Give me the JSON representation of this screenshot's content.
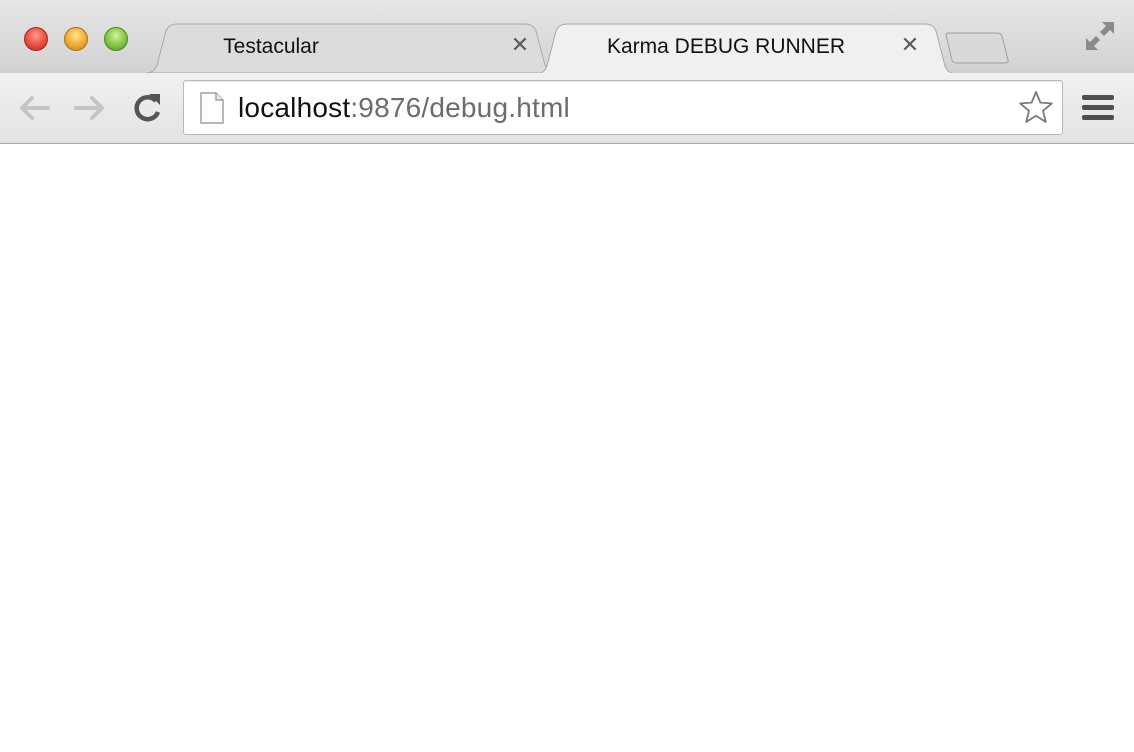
{
  "window": {
    "tabs": [
      {
        "title": "Testacular",
        "active": false
      },
      {
        "title": "Karma DEBUG RUNNER",
        "active": true
      }
    ]
  },
  "toolbar": {
    "url_host": "localhost",
    "url_rest": ":9876/debug.html"
  },
  "icons": {
    "back": "back-arrow-icon",
    "forward": "forward-arrow-icon",
    "reload": "reload-icon",
    "page": "page-icon",
    "bookmark": "star-icon",
    "menu": "hamburger-menu-icon",
    "fullscreen": "fullscreen-icon",
    "close_tab": "close-icon"
  },
  "colors": {
    "tabstrip": "#d8d8d8",
    "active_tab": "#efefef",
    "url_host": "#111111",
    "url_rest": "#6c6c6c"
  }
}
